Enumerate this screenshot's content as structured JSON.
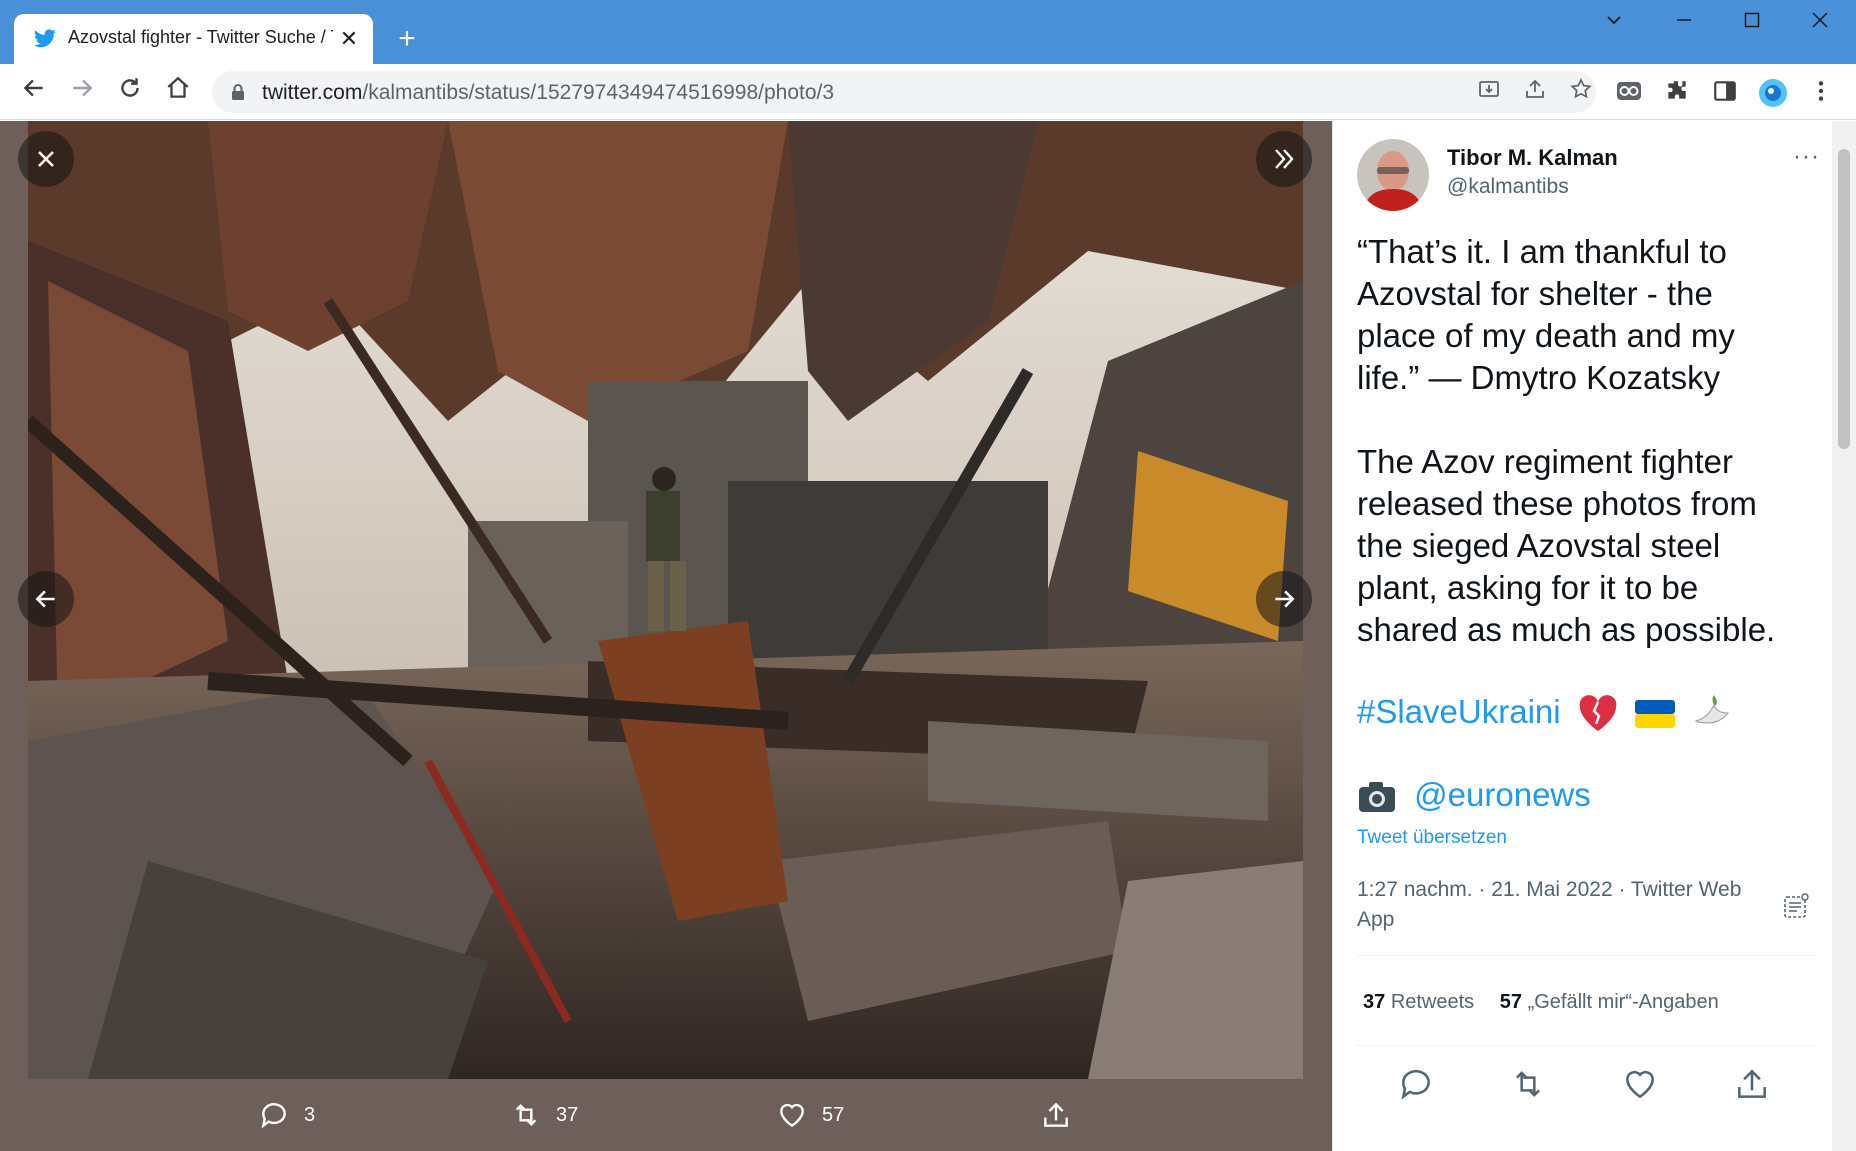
{
  "browser": {
    "tab_title": "Azovstal fighter - Twitter Suche / Twitter",
    "tab_close": "✕",
    "new_tab": "+",
    "url_host": "twitter.com",
    "url_path": "/kalmantibs/status/1527974349474516998/photo/3",
    "colors": {
      "titlebar": "#4a90d9",
      "toolbar": "#ffffff"
    }
  },
  "viewer": {
    "close_icon": "close-icon",
    "expand_icon": "double-chevron-right-icon",
    "prev_icon": "arrow-left-icon",
    "next_icon": "arrow-right-icon",
    "actions": {
      "reply_count": "3",
      "retweet_count": "37",
      "like_count": "57"
    }
  },
  "tweet": {
    "author_name": "Tibor M. Kalman",
    "author_handle": "@kalmantibs",
    "more": "···",
    "paragraph_1": "“That’s it. I am thankful to Azovstal for shelter - the place of my death and my life.” — Dmytro Kozatsky",
    "paragraph_2": "The Azov regiment fighter released these photos from the sieged Azovstal steel plant, asking for it to be shared as much as possible.",
    "hashtag": "#SlaveUkraini",
    "mention": "@euronews",
    "translate_label": "Tweet übersetzen",
    "timestamp": "1:27 nachm. · 21. Mai 2022 · Twitter Web App",
    "retweets_count": "37",
    "retweets_label": "Retweets",
    "likes_count": "57",
    "likes_label": "„Gefällt mir“-Angaben",
    "accent_color": "#1d9bf0"
  }
}
